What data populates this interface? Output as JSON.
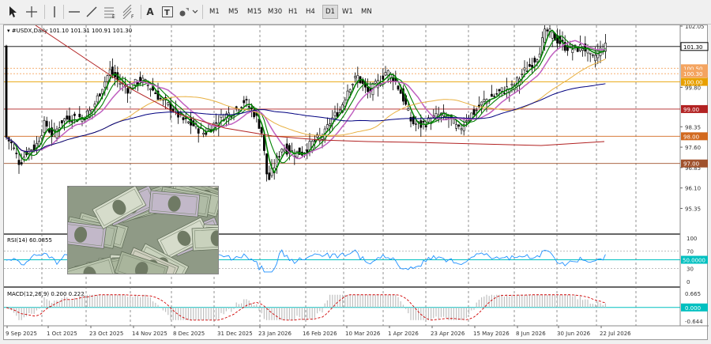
{
  "toolbar": {
    "timeframes": [
      "M1",
      "M5",
      "M15",
      "M30",
      "H1",
      "H4",
      "D1",
      "W1",
      "MN"
    ],
    "active_timeframe": "D1",
    "tools": [
      "cursor-icon",
      "crosshair-icon",
      "vertical-line-icon",
      "horizontal-line-icon",
      "trendline-icon",
      "fibonacci-icon",
      "fibonacci-channel-icon",
      "text-icon",
      "text-label-icon",
      "shapes-icon"
    ]
  },
  "main": {
    "header": "#USDX,Daily  101.10 101.31 100.91 101.30",
    "price_labels": [
      "102.05",
      "99.80",
      "98.35",
      "97.60",
      "96.85",
      "96.10",
      "95.35"
    ],
    "level_badges": [
      {
        "text": "101.30",
        "color": "#000000"
      },
      {
        "text": "100.50",
        "color": "#f4a460"
      },
      {
        "text": "100.30",
        "color": "#f4a460"
      },
      {
        "text": "100.00",
        "color": "#e8a000"
      },
      {
        "text": "99.00",
        "color": "#b22222"
      },
      {
        "text": "98.00",
        "color": "#d2691e"
      },
      {
        "text": "97.00",
        "color": "#a0522d"
      }
    ]
  },
  "rsi": {
    "header": "RSI(14) 60.0855",
    "scale": [
      "100",
      "70",
      "30",
      "0"
    ],
    "badge": "50.0000"
  },
  "macd": {
    "header": "MACD(12,26,9) 0.200 0.222",
    "scale": [
      "0.665",
      "0.000",
      "-0.644"
    ],
    "badge": "0.000"
  },
  "xaxis": [
    "9 Sep 2025",
    "1 Oct 2025",
    "23 Oct 2025",
    "14 Nov 2025",
    "8 Dec 2025",
    "31 Dec 2025",
    "23 Jan 2026",
    "16 Feb 2026",
    "10 Mar 2026",
    "1 Apr 2026",
    "23 Apr 2026",
    "15 May 2026",
    "8 Jun 2026",
    "30 Jun 2026",
    "22 Jul 2026"
  ],
  "colors": {
    "up_candle": "#000000",
    "ma_fast": "#008000",
    "ma_mid": "#c060c0",
    "ma_slow": "#e8b040",
    "ma_long": "#000080",
    "ma_200": "#b22222",
    "rsi_line": "#1e90ff",
    "macd_hist": "#c0c0c0",
    "macd_signal": "#d00000",
    "zero_line": "#00c0c0"
  },
  "photo": {
    "subject": "us-dollar-banknotes"
  }
}
